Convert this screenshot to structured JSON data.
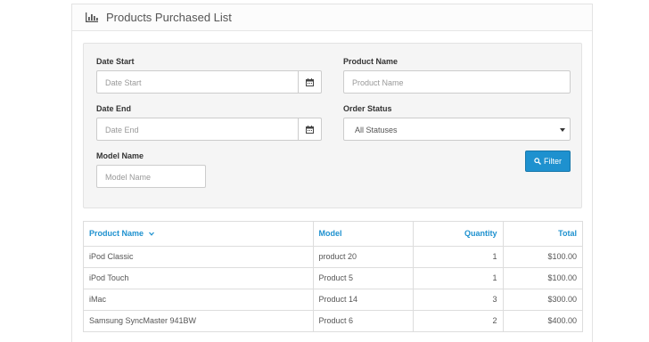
{
  "panel": {
    "title": "Products Purchased List"
  },
  "filters": {
    "date_start": {
      "label": "Date Start",
      "placeholder": "Date Start"
    },
    "date_end": {
      "label": "Date End",
      "placeholder": "Date End"
    },
    "model_name": {
      "label": "Model Name",
      "placeholder": "Model Name"
    },
    "product_name": {
      "label": "Product Name",
      "placeholder": "Product Name"
    },
    "order_status": {
      "label": "Order Status",
      "selected": "All Statuses"
    },
    "filter_button": "Filter"
  },
  "table": {
    "headers": [
      "Product Name",
      "Model",
      "Quantity",
      "Total"
    ],
    "rows": [
      [
        "iPod Classic",
        "product 20",
        "1",
        "$100.00"
      ],
      [
        "iPod Touch",
        "Product 5",
        "1",
        "$100.00"
      ],
      [
        "iMac",
        "Product 14",
        "3",
        "$300.00"
      ],
      [
        "Samsung SyncMaster 941BW",
        "Product 6",
        "2",
        "$400.00"
      ]
    ]
  },
  "colors": {
    "accent": "#1e91cf",
    "well": "#f5f5f5"
  },
  "icons": {
    "title": "bar-chart-icon",
    "date": "calendar-icon",
    "filter": "search-icon",
    "sort": "chevron-down-icon"
  }
}
